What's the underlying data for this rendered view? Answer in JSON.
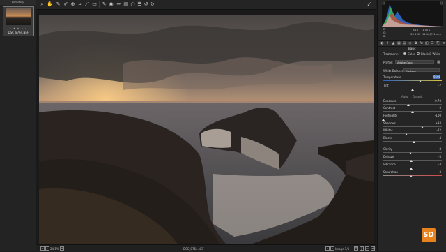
{
  "filmstrip": {
    "title": "Filmstrip",
    "thumbnail_name": "DSC_8764.NEF",
    "stars": "• • • • •"
  },
  "toolbar": {
    "tools": [
      "zoom-icon",
      "hand-icon",
      "white-balance-icon",
      "color-sampler-icon",
      "target-adjust-icon",
      "crop-icon",
      "straighten-icon",
      "transform-icon",
      "spot-removal-icon",
      "red-eye-icon",
      "adjustment-brush-icon",
      "graduated-filter-icon",
      "radial-filter-icon",
      "preferences-icon",
      "rotate-left-icon",
      "rotate-right-icon"
    ],
    "right_icon": "fullscreen-icon"
  },
  "status": {
    "zoom": "24.1%",
    "filename": "DSC_8764.NEF",
    "image_counter": "Image 1/1"
  },
  "exif": {
    "r": "R:",
    "g": "G:",
    "b": "B:",
    "aperture": "f/16",
    "shutter": "1.30 s",
    "iso": "ISO 100",
    "lens": "11-16@11 mm"
  },
  "panel": {
    "section_title": "Basic",
    "treatment_label": "Treatment:",
    "color_option": "Color",
    "bw_option": "Black & White",
    "profile_label": "Profile:",
    "profile_value": "Adobe Color",
    "wb_label": "White Balance:",
    "wb_value": "Custom",
    "auto_label": "Auto",
    "default_label": "Default"
  },
  "sliders": [
    {
      "label": "Temperature",
      "value": "9500",
      "pos": 0.63
    },
    {
      "label": "Tint",
      "value": "-7",
      "pos": 0.5
    },
    {
      "label": "Exposure",
      "value": "-0.70",
      "pos": 0.43
    },
    {
      "label": "Contrast",
      "value": "0",
      "pos": 0.5
    },
    {
      "label": "Highlights",
      "value": "-100",
      "pos": 0.0
    },
    {
      "label": "Shadows",
      "value": "+34",
      "pos": 0.67
    },
    {
      "label": "Whites",
      "value": "-22",
      "pos": 0.39
    },
    {
      "label": "Blacks",
      "value": "+4",
      "pos": 0.52
    },
    {
      "label": "Clarity",
      "value": "-8",
      "pos": 0.46
    },
    {
      "label": "Dehaze",
      "value": "-3",
      "pos": 0.48
    },
    {
      "label": "Vibrance",
      "value": "-3",
      "pos": 0.48
    },
    {
      "label": "Saturation",
      "value": "-3",
      "pos": 0.48
    }
  ],
  "colors": {
    "temperature_track": [
      "#2f5fbf",
      "#d9c13a"
    ],
    "tint_track": [
      "#3fa13f",
      "#c43fc4"
    ],
    "saturation_track": [
      "#8a8a8a",
      "#d24a4a"
    ],
    "accent": "#e8821e"
  },
  "logo_text": "SD"
}
